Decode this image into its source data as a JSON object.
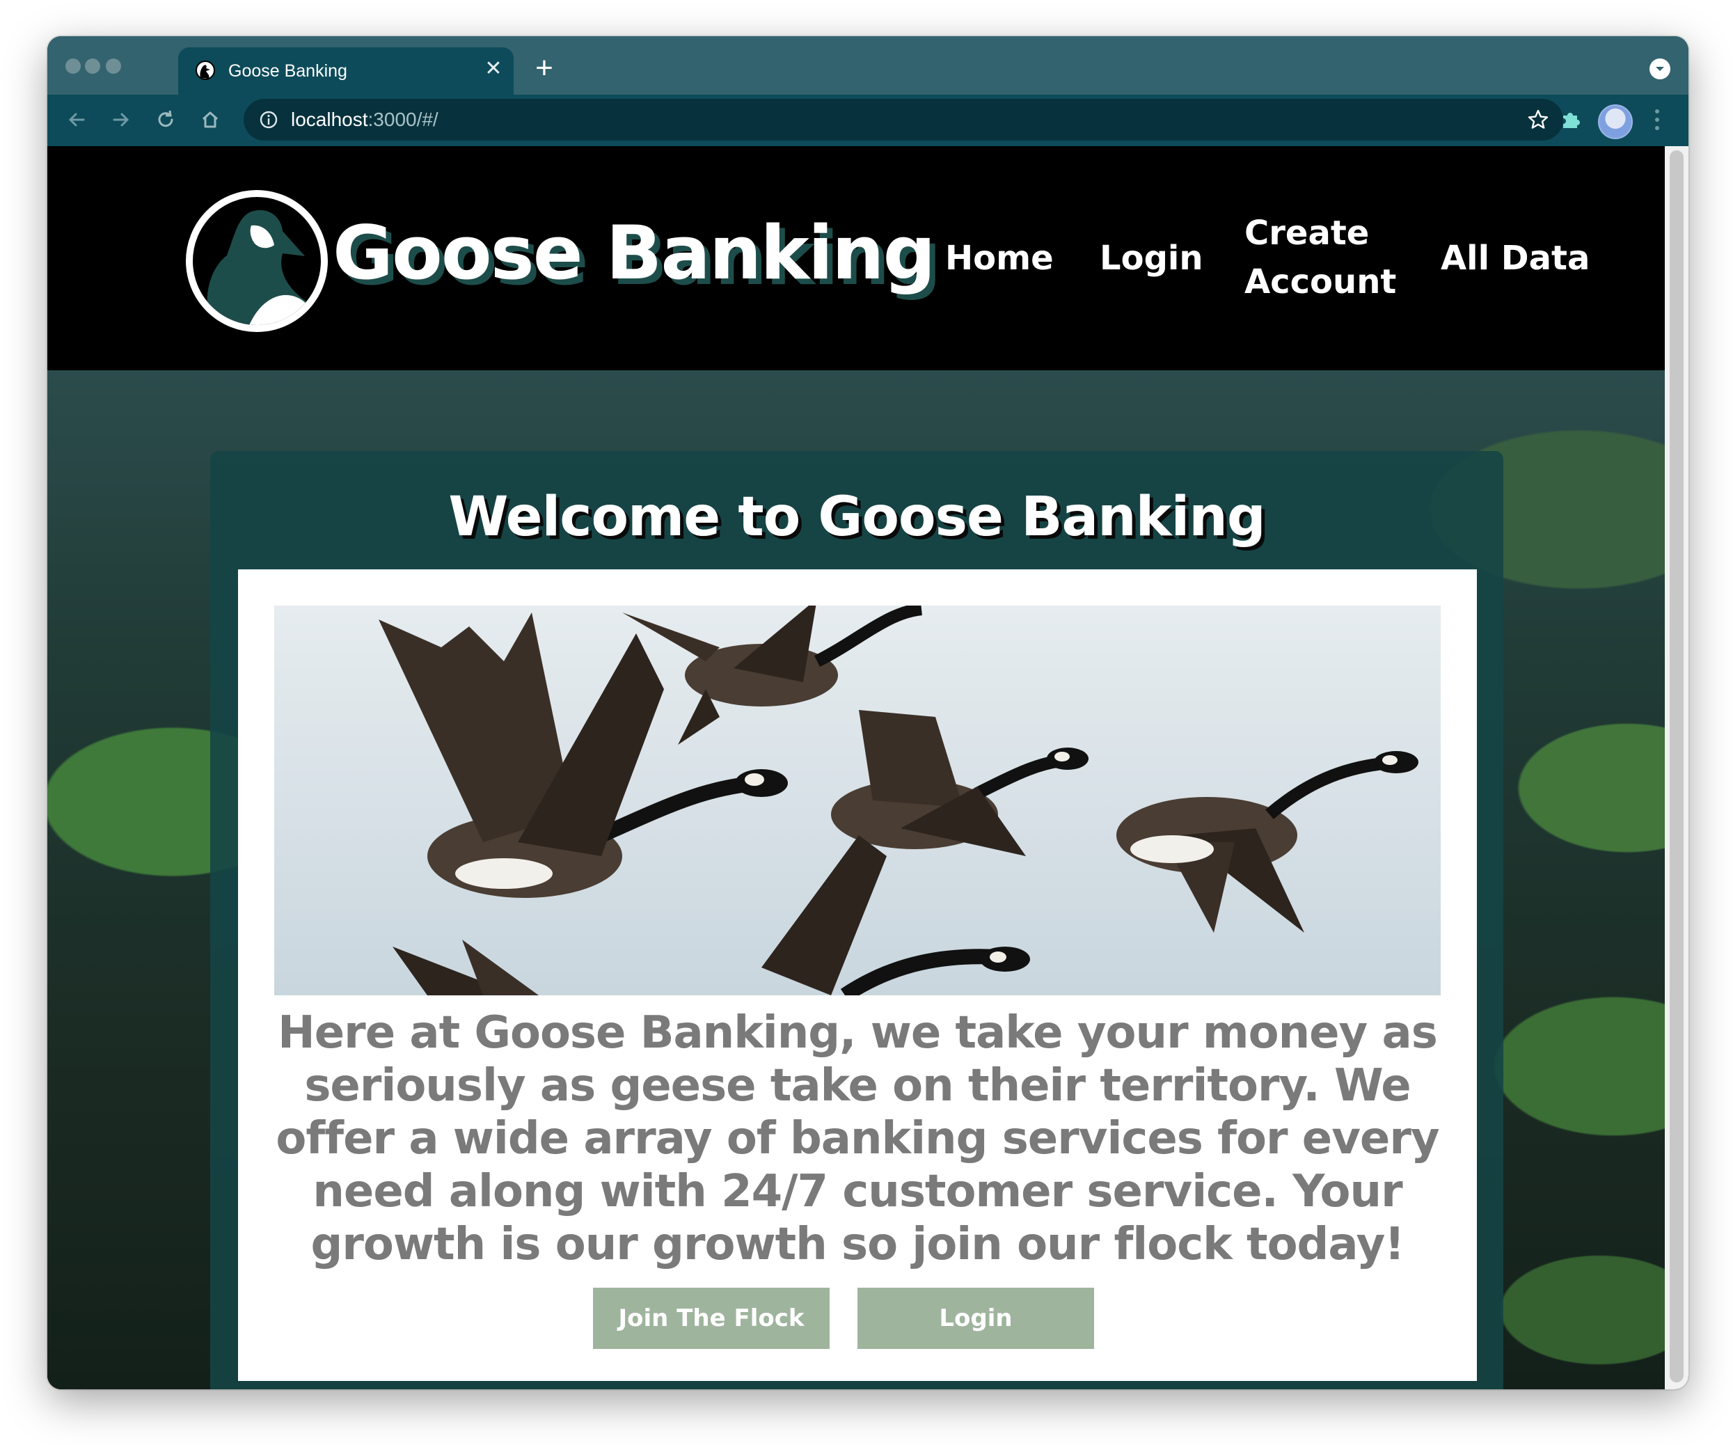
{
  "browser": {
    "tab_title": "Goose Banking",
    "url_host": "localhost",
    "url_rest": ":3000/#/",
    "colors": {
      "tabstrip": "#33636e",
      "toolbar": "#0d4b5a",
      "omnibox": "#07323d"
    }
  },
  "site": {
    "brand": "Goose Banking",
    "nav": {
      "home": "Home",
      "login": "Login",
      "create_line1": "Create",
      "create_line2": "Account",
      "all_data": "All Data"
    },
    "card": {
      "title": "Welcome to Goose Banking",
      "intro": "Here at Goose Banking, we take your money as seriously as geese take on their territory. We offer a wide array of banking services for every need along with 24/7 customer service. Your growth is our growth so join our flock today!",
      "join_button": "Join The Flock",
      "login_button": "Login"
    },
    "colors": {
      "header": "#000000",
      "card": "#144446",
      "button": "#9fb49d",
      "intro_text": "#7a7a7a",
      "brand_shadow": "#1d4d4a"
    }
  },
  "icons": [
    "goose-favicon-icon",
    "close-icon",
    "plus-icon",
    "back-icon",
    "forward-icon",
    "reload-icon",
    "home-icon",
    "info-icon",
    "star-icon",
    "puzzle-icon",
    "kebab-menu-icon",
    "goose-logo-icon"
  ]
}
